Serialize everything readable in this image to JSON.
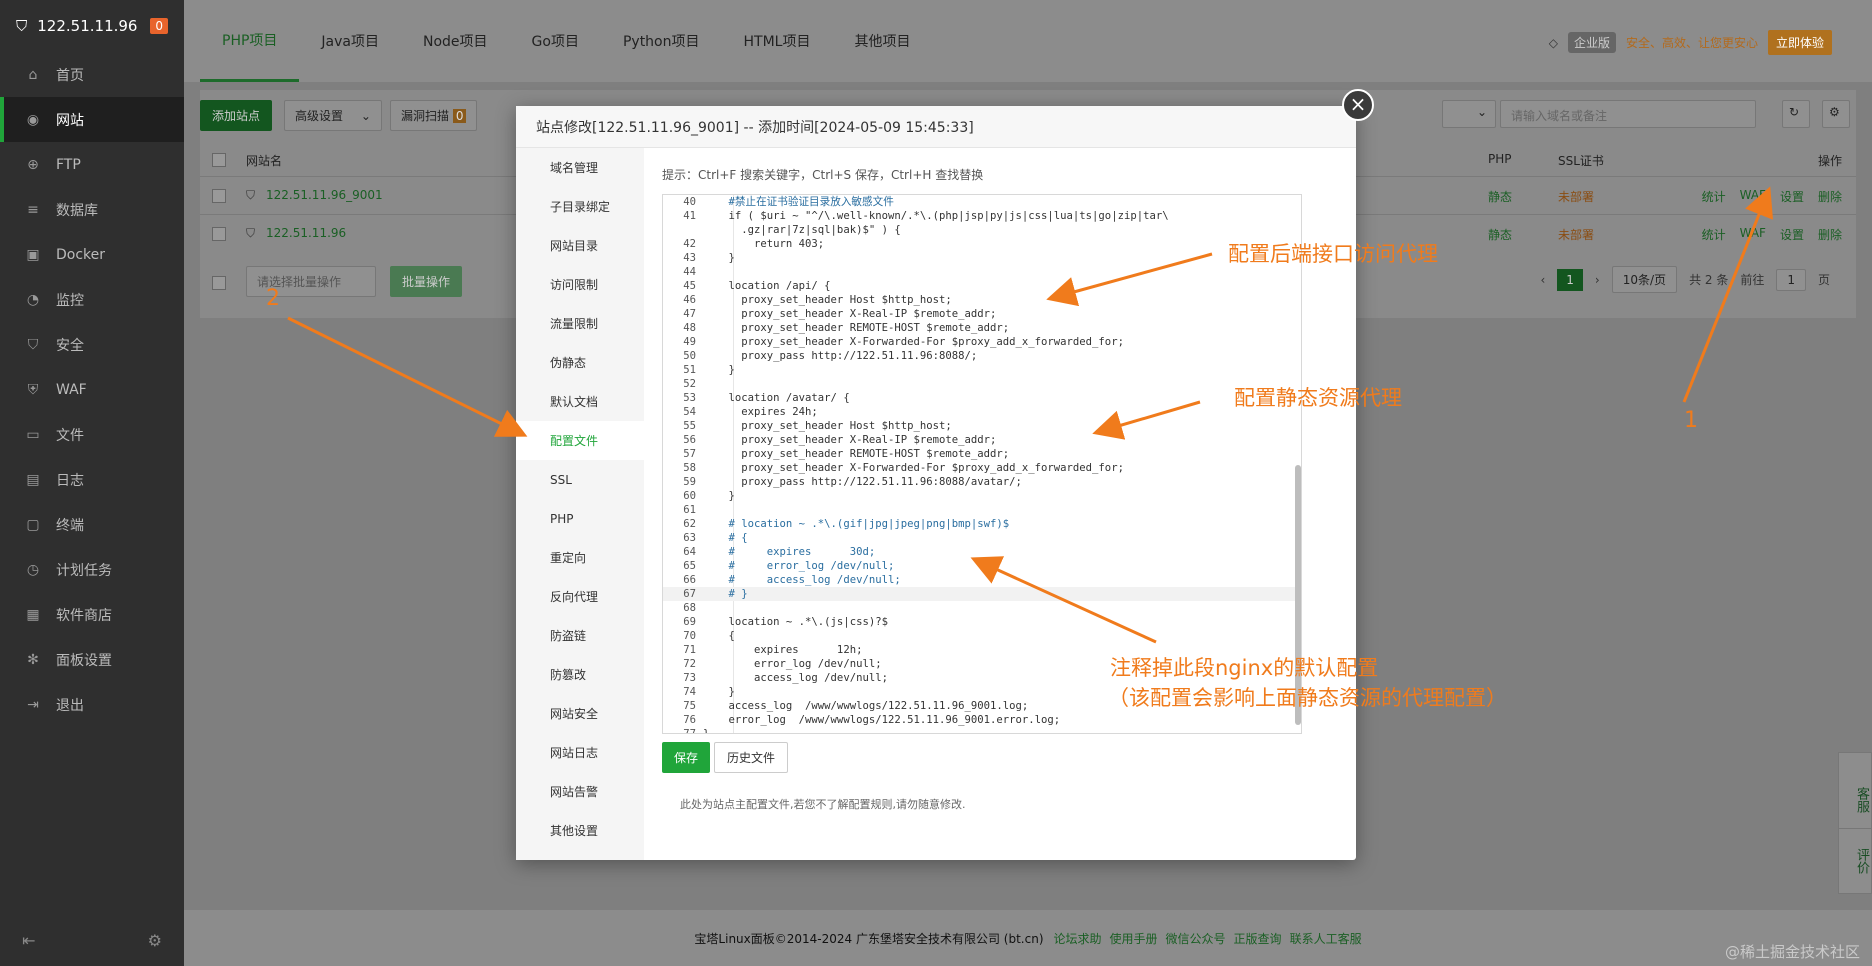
{
  "sidebar": {
    "server_ip": "122.51.11.96",
    "notice_count": "0",
    "items": [
      {
        "label": "首页",
        "icon": "home-icon",
        "glyph": "⌂"
      },
      {
        "label": "网站",
        "icon": "globe-icon",
        "glyph": "◉"
      },
      {
        "label": "FTP",
        "icon": "ftp-icon",
        "glyph": "⊕"
      },
      {
        "label": "数据库",
        "icon": "database-icon",
        "glyph": "≡"
      },
      {
        "label": "Docker",
        "icon": "docker-icon",
        "glyph": "▣"
      },
      {
        "label": "监控",
        "icon": "monitor-icon",
        "glyph": "◔"
      },
      {
        "label": "安全",
        "icon": "shield-icon",
        "glyph": "⛉"
      },
      {
        "label": "WAF",
        "icon": "waf-icon",
        "glyph": "⛨"
      },
      {
        "label": "文件",
        "icon": "folder-icon",
        "glyph": "▭"
      },
      {
        "label": "日志",
        "icon": "log-icon",
        "glyph": "▤"
      },
      {
        "label": "终端",
        "icon": "terminal-icon",
        "glyph": "▢"
      },
      {
        "label": "计划任务",
        "icon": "clock-icon",
        "glyph": "◷"
      },
      {
        "label": "软件商店",
        "icon": "store-icon",
        "glyph": "▦"
      },
      {
        "label": "面板设置",
        "icon": "gear-icon",
        "glyph": "✻"
      },
      {
        "label": "退出",
        "icon": "logout-icon",
        "glyph": "⇥"
      }
    ],
    "active_index": 1
  },
  "tabs": [
    "PHP项目",
    "Java项目",
    "Node项目",
    "Go项目",
    "Python项目",
    "HTML项目",
    "其他项目"
  ],
  "promo": {
    "badge": "企业版",
    "text": "安全、高效、让您更安心",
    "button": "立即体验"
  },
  "toolbar": {
    "add_site": "添加站点",
    "advanced": "高级设置",
    "vuln_scan": "漏洞扫描",
    "vuln_count": "0",
    "search_placeholder": "请输入域名或备注",
    "batch_placeholder": "请选择批量操作",
    "batch_button": "批量操作"
  },
  "table": {
    "headers": {
      "name": "网站名",
      "php": "PHP",
      "ssl": "SSL证书",
      "ops": "操作"
    },
    "rows": [
      {
        "name": "122.51.11.96_9001",
        "php": "静态",
        "ssl": "未部署"
      },
      {
        "name": "122.51.11.96",
        "php": "静态",
        "ssl": "未部署"
      }
    ],
    "row_actions": [
      "统计",
      "WAF",
      "设置",
      "删除"
    ]
  },
  "pagination": {
    "page": "1",
    "per_page": "10条/页",
    "total": "共 2 条",
    "goto_prefix": "前往",
    "goto_value": "1",
    "goto_suffix": "页"
  },
  "footer": {
    "copyright": "宝塔Linux面板©2014-2024 广东堡塔安全技术有限公司 (bt.cn)",
    "links": [
      "论坛求助",
      "使用手册",
      "微信公众号",
      "正版查询",
      "联系人工客服"
    ]
  },
  "float_buttons": [
    "客服",
    "评价"
  ],
  "watermark": "@稀土掘金技术社区",
  "modal": {
    "title": "站点修改[122.51.11.96_9001] -- 添加时间[2024-05-09 15:45:33]",
    "nav": [
      "域名管理",
      "子目录绑定",
      "网站目录",
      "访问限制",
      "流量限制",
      "伪静态",
      "默认文档",
      "配置文件",
      "SSL",
      "PHP",
      "重定向",
      "反向代理",
      "防盗链",
      "防篡改",
      "网站安全",
      "网站日志",
      "网站告警",
      "其他设置"
    ],
    "active_nav": 7,
    "hint": "提示：Ctrl+F 搜索关键字，Ctrl+S 保存，Ctrl+H 查找替换",
    "save": "保存",
    "history": "历史文件",
    "note": "此处为站点主配置文件,若您不了解配置规则,请勿随意修改."
  },
  "code_lines": [
    {
      "n": "40",
      "t": "    #禁止在证书验证目录放入敏感文件",
      "cls": "cm"
    },
    {
      "n": "41",
      "t": "    if ( $uri ~ \"^/\\.well-known/.*\\.(php|jsp|py|js|css|lua|ts|go|zip|tar\\"
    },
    {
      "n": "",
      "t": "      .gz|rar|7z|sql|bak)$\" ) {"
    },
    {
      "n": "42",
      "t": "        return 403;"
    },
    {
      "n": "43",
      "t": "    }"
    },
    {
      "n": "44",
      "t": ""
    },
    {
      "n": "45",
      "t": "    location /api/ {"
    },
    {
      "n": "46",
      "t": "      proxy_set_header Host $http_host;"
    },
    {
      "n": "47",
      "t": "      proxy_set_header X-Real-IP $remote_addr;"
    },
    {
      "n": "48",
      "t": "      proxy_set_header REMOTE-HOST $remote_addr;"
    },
    {
      "n": "49",
      "t": "      proxy_set_header X-Forwarded-For $proxy_add_x_forwarded_for;"
    },
    {
      "n": "50",
      "t": "      proxy_pass http://122.51.11.96:8088/;"
    },
    {
      "n": "51",
      "t": "    }"
    },
    {
      "n": "52",
      "t": ""
    },
    {
      "n": "53",
      "t": "    location /avatar/ {"
    },
    {
      "n": "54",
      "t": "      expires 24h;"
    },
    {
      "n": "55",
      "t": "      proxy_set_header Host $http_host;"
    },
    {
      "n": "56",
      "t": "      proxy_set_header X-Real-IP $remote_addr;"
    },
    {
      "n": "57",
      "t": "      proxy_set_header REMOTE-HOST $remote_addr;"
    },
    {
      "n": "58",
      "t": "      proxy_set_header X-Forwarded-For $proxy_add_x_forwarded_for;"
    },
    {
      "n": "59",
      "t": "      proxy_pass http://122.51.11.96:8088/avatar/;"
    },
    {
      "n": "60",
      "t": "    }"
    },
    {
      "n": "61",
      "t": ""
    },
    {
      "n": "62",
      "t": "    # location ~ .*\\.(gif|jpg|jpeg|png|bmp|swf)$",
      "cls": "cm"
    },
    {
      "n": "63",
      "t": "    # {",
      "cls": "cm"
    },
    {
      "n": "64",
      "t": "    #     expires      30d;",
      "cls": "cm"
    },
    {
      "n": "65",
      "t": "    #     error_log /dev/null;",
      "cls": "cm"
    },
    {
      "n": "66",
      "t": "    #     access_log /dev/null;",
      "cls": "cm"
    },
    {
      "n": "67",
      "t": "    # }",
      "cls": "cm",
      "hl": true
    },
    {
      "n": "68",
      "t": ""
    },
    {
      "n": "69",
      "t": "    location ~ .*\\.(js|css)?$"
    },
    {
      "n": "70",
      "t": "    {"
    },
    {
      "n": "71",
      "t": "        expires      12h;"
    },
    {
      "n": "72",
      "t": "        error_log /dev/null;"
    },
    {
      "n": "73",
      "t": "        access_log /dev/null;"
    },
    {
      "n": "74",
      "t": "    }"
    },
    {
      "n": "75",
      "t": "    access_log  /www/wwwlogs/122.51.11.96_9001.log;"
    },
    {
      "n": "76",
      "t": "    error_log  /www/wwwlogs/122.51.11.96_9001.error.log;"
    },
    {
      "n": "77",
      "t": "}"
    }
  ],
  "annotations": {
    "a1": "配置后端接口访问代理",
    "a2": "配置静态资源代理",
    "a3": "注释掉此段nginx的默认配置",
    "a3b": "（该配置会影响上面静态资源的代理配置）",
    "n1": "1",
    "n2": "2"
  },
  "colors": {
    "accent": "#20a53a",
    "annotation": "#f07b1c",
    "sidebar_bg": "#2f2f2f"
  }
}
